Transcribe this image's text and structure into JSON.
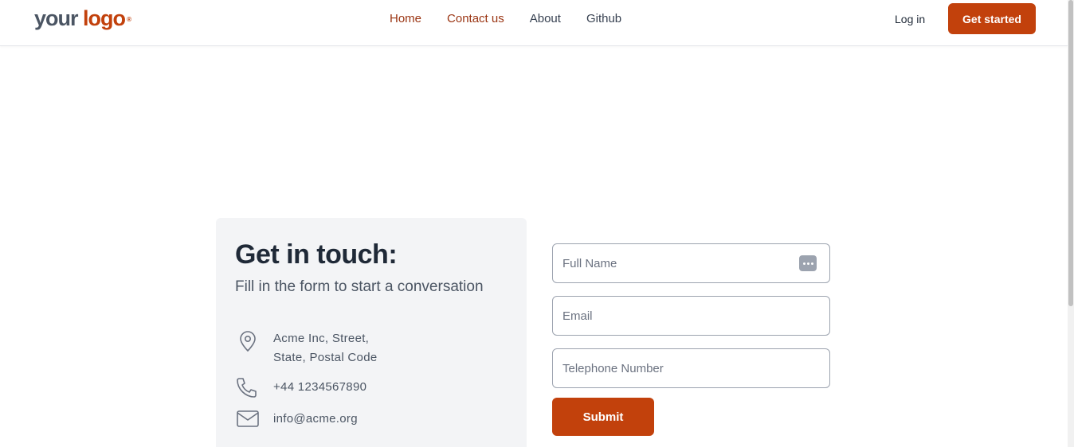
{
  "header": {
    "logo": {
      "word1": "your",
      "word2": "logo",
      "mark": "®"
    },
    "nav": [
      {
        "label": "Home",
        "active": true
      },
      {
        "label": "Contact us",
        "active": true
      },
      {
        "label": "About",
        "active": false
      },
      {
        "label": "Github",
        "active": false
      }
    ],
    "login_label": "Log in",
    "cta_label": "Get started"
  },
  "contact": {
    "title": "Get in touch:",
    "subtitle": "Fill in the form to start a conversation",
    "address_line1": "Acme Inc, Street,",
    "address_line2": "State, Postal Code",
    "phone": "+44 1234567890",
    "email": "info@acme.org"
  },
  "form": {
    "full_name_placeholder": "Full Name",
    "email_placeholder": "Email",
    "telephone_placeholder": "Telephone Number",
    "submit_label": "Submit"
  },
  "icons": {
    "address": "map-pin-icon",
    "phone": "phone-icon",
    "email": "mail-icon",
    "autofill": "password-manager-icon"
  },
  "colors": {
    "accent": "#c2410c",
    "nav_active": "#9a3412",
    "card_bg": "#f3f4f6",
    "heading": "#1f2937"
  }
}
